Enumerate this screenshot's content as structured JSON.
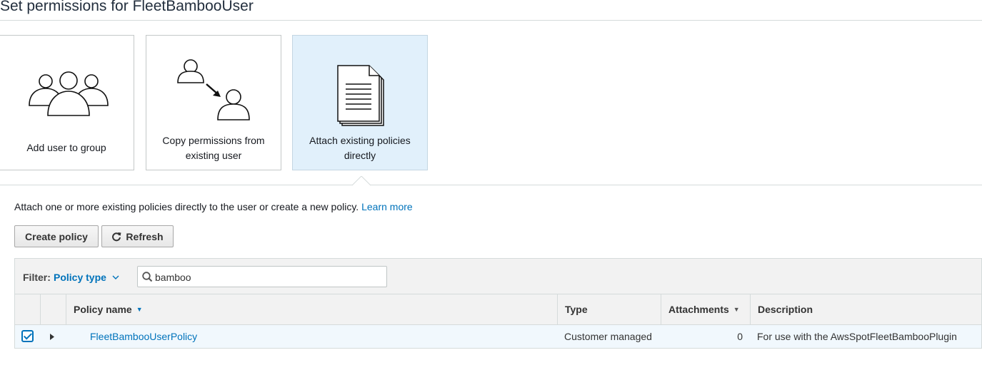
{
  "page": {
    "title": "Set permissions for FleetBambooUser"
  },
  "options": [
    {
      "label": "Add user to group",
      "icon": "group-icon",
      "selected": false
    },
    {
      "label": "Copy permissions from existing user",
      "icon": "copy-user-icon",
      "selected": false
    },
    {
      "label": "Attach existing policies directly",
      "icon": "document-icon",
      "selected": true
    }
  ],
  "intro": {
    "text": "Attach one or more existing policies directly to the user or create a new policy.",
    "link": "Learn more"
  },
  "toolbar": {
    "create_label": "Create policy",
    "refresh_label": "Refresh"
  },
  "filter": {
    "label": "Filter:",
    "type_label": "Policy type",
    "search_value": "bamboo"
  },
  "table": {
    "columns": [
      "Policy name",
      "Type",
      "Attachments",
      "Description"
    ],
    "rows": [
      {
        "checked": true,
        "name": "FleetBambooUserPolicy",
        "type": "Customer managed",
        "attachments": "0",
        "description": "For use with the AwsSpotFleetBambooPlugin"
      }
    ]
  },
  "colors": {
    "link": "#0073bb",
    "selected_tile": "#e1f0fb",
    "selected_row": "#f1f8fd"
  }
}
